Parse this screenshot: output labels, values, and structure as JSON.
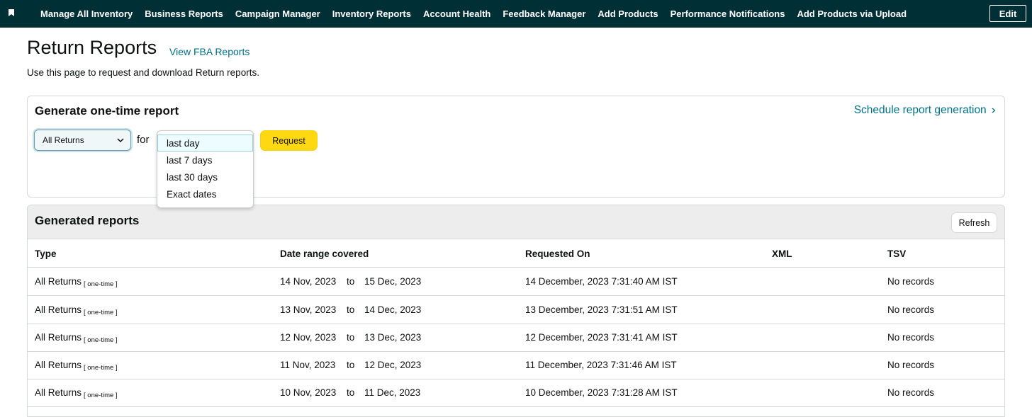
{
  "topnav": {
    "links": [
      "Manage All Inventory",
      "Business Reports",
      "Campaign Manager",
      "Inventory Reports",
      "Account Health",
      "Feedback Manager",
      "Add Products",
      "Performance Notifications",
      "Add Products via Upload"
    ],
    "edit_label": "Edit"
  },
  "header": {
    "title": "Return Reports",
    "fba_link": "View FBA Reports",
    "description": "Use this page to request and download Return reports."
  },
  "generate": {
    "title": "Generate one-time report",
    "schedule_link": "Schedule report generation",
    "type_value": "All Returns",
    "for_label": "for",
    "request_label": "Request",
    "period_options": [
      "last day",
      "last 7 days",
      "last 30 days",
      "Exact dates"
    ],
    "selected_period": "last day"
  },
  "reports": {
    "title": "Generated reports",
    "refresh_label": "Refresh",
    "columns": [
      "Type",
      "Date range covered",
      "Requested On",
      "XML",
      "TSV"
    ],
    "rows": [
      {
        "type": "All Returns",
        "tag": "[ one-time ]",
        "from": "14 Nov, 2023",
        "to_label": "to",
        "to": "15 Dec, 2023",
        "requested": "14 December, 2023 7:31:40 AM IST",
        "xml": "",
        "tsv": "No records"
      },
      {
        "type": "All Returns",
        "tag": "[ one-time ]",
        "from": "13 Nov, 2023",
        "to_label": "to",
        "to": "14 Dec, 2023",
        "requested": "13 December, 2023 7:31:51 AM IST",
        "xml": "",
        "tsv": "No records"
      },
      {
        "type": "All Returns",
        "tag": "[ one-time ]",
        "from": "12 Nov, 2023",
        "to_label": "to",
        "to": "13 Dec, 2023",
        "requested": "12 December, 2023 7:31:41 AM IST",
        "xml": "",
        "tsv": "No records"
      },
      {
        "type": "All Returns",
        "tag": "[ one-time ]",
        "from": "11 Nov, 2023",
        "to_label": "to",
        "to": "12 Dec, 2023",
        "requested": "11 December, 2023 7:31:46 AM IST",
        "xml": "",
        "tsv": "No records"
      },
      {
        "type": "All Returns",
        "tag": "[ one-time ]",
        "from": "10 Nov, 2023",
        "to_label": "to",
        "to": "11 Dec, 2023",
        "requested": "10 December, 2023 7:31:28 AM IST",
        "xml": "",
        "tsv": "No records"
      }
    ]
  },
  "colors": {
    "nav_bg": "#002f36",
    "link": "#007185",
    "request_button": "#ffd814",
    "panel_header_bg": "#ededed"
  },
  "icons": {
    "bookmark": "bookmark-icon",
    "select_chevron": "chevron-down-icon",
    "schedule_chevron": "chevron-right-icon"
  }
}
